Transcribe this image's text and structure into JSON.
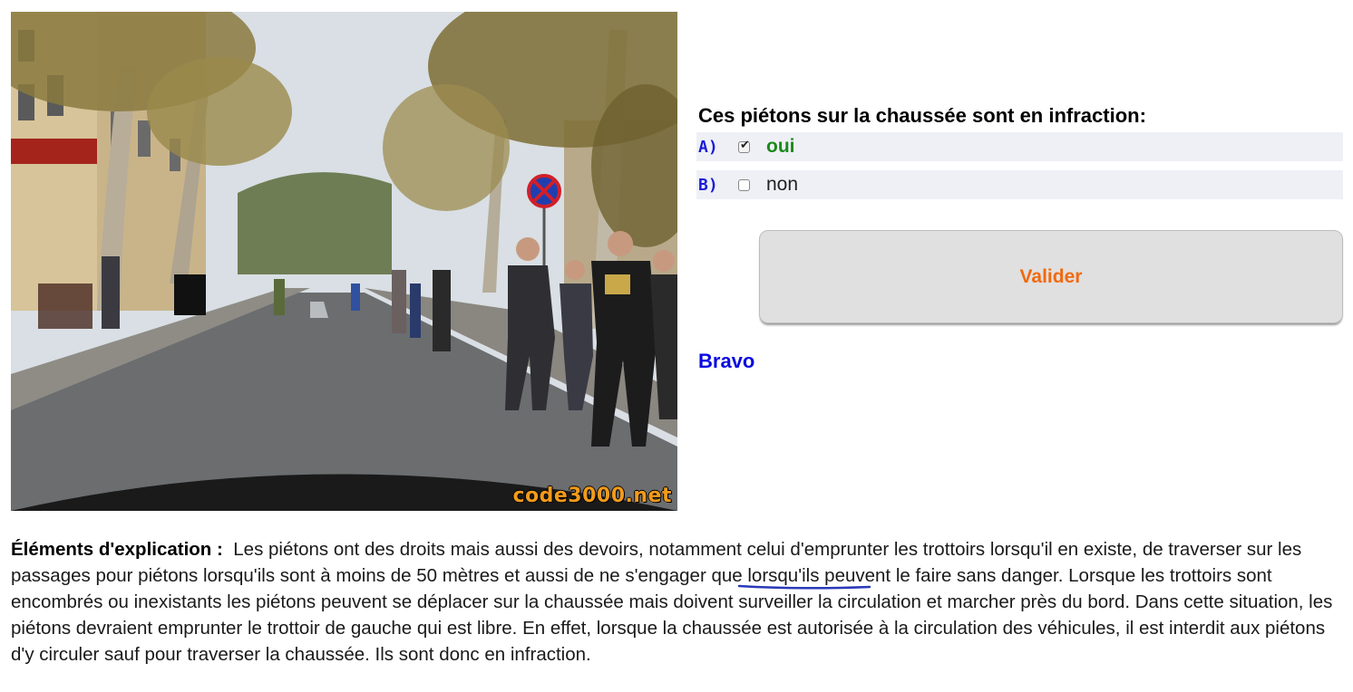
{
  "photo": {
    "watermark": "code3000.net",
    "alt_description_icon": "photo-street-pedestrians"
  },
  "question": {
    "text": "Ces piétons sur la chaussée sont en infraction:",
    "answers": [
      {
        "letter": "A)",
        "label": "oui",
        "checked": true,
        "correct": true
      },
      {
        "letter": "B)",
        "label": "non",
        "checked": false,
        "correct": false
      }
    ]
  },
  "validate_label": "Valider",
  "result_text": "Bravo",
  "explanation": {
    "heading": "Éléments d'explication :",
    "body": "Les piétons ont des droits mais aussi des devoirs, notamment celui d'emprunter les trottoirs lorsqu'il en existe, de traverser sur les passages pour piétons lorsqu'ils sont à moins de 50 mètres et aussi de ne s'engager que lorsqu'ils peuvent le faire sans danger. Lorsque les trottoirs sont encombrés ou inexistants les piétons peuvent se déplacer sur la chaussée mais doivent surveiller la circulation et marcher près du bord. Dans cette situation, les piétons devraient emprunter le trottoir de gauche qui est libre. En effet, lorsque la chaussée est autorisée à la circulation des véhicules, il est interdit aux piétons d'y circuler sauf pour traverser la chaussée. Ils sont donc en infraction."
  },
  "colors": {
    "question_letter": "#1a1ad8",
    "correct_answer": "#1a8a1a",
    "validate_text": "#f06a10",
    "bravo": "#0a0ae0",
    "annotation_underline": "#2a3ab8"
  }
}
